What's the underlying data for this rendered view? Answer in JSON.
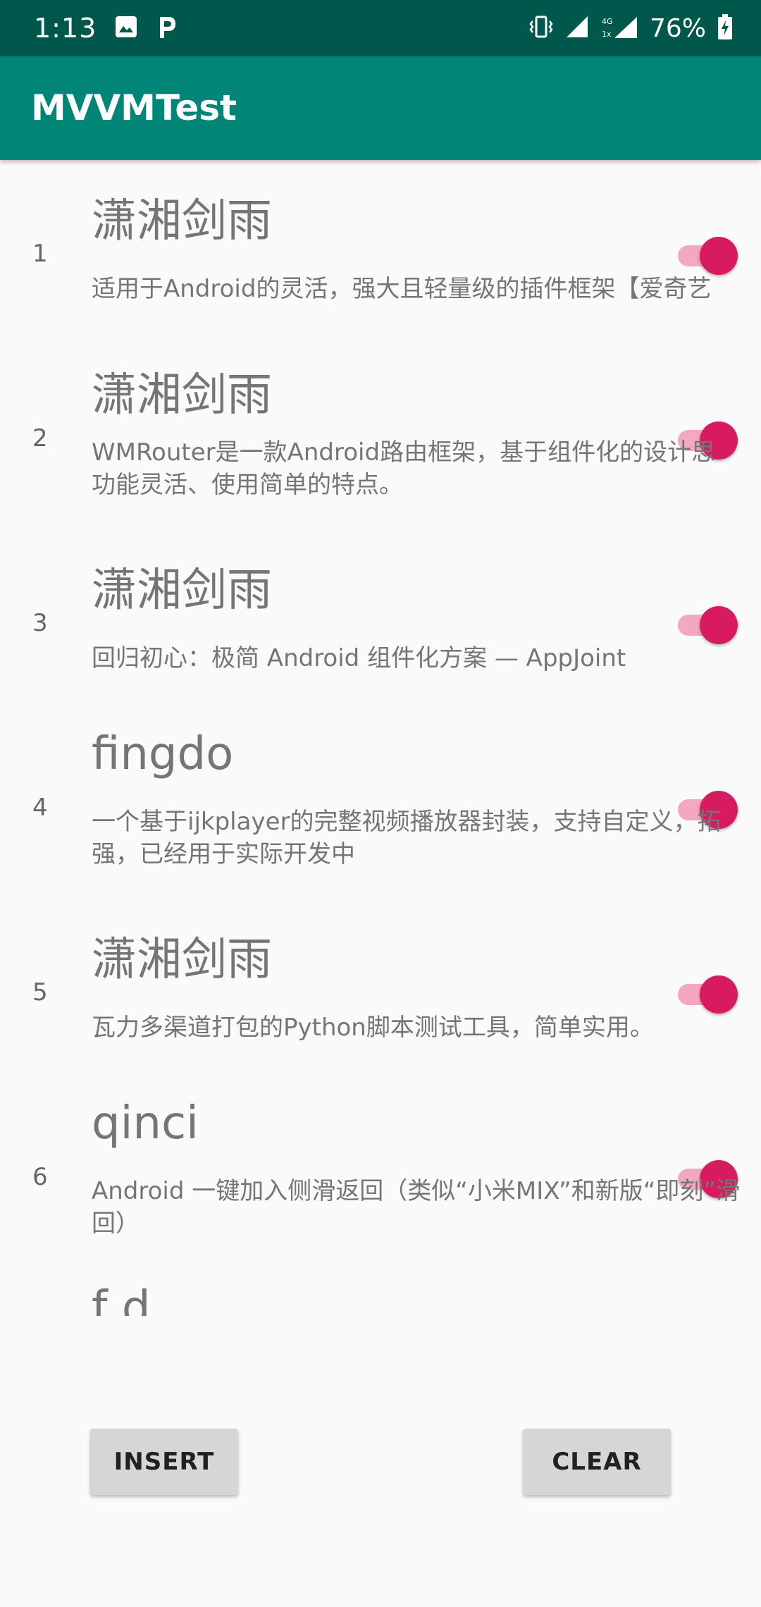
{
  "status_bar": {
    "time": "1:13",
    "battery": "76%",
    "icons": [
      "image-icon",
      "parking-icon",
      "vibrate-icon",
      "signal-icon",
      "data-4g-icon",
      "battery-charging-icon"
    ]
  },
  "app_bar": {
    "title": "MVVMTest"
  },
  "list": {
    "items": [
      {
        "index": "1",
        "title": "潇湘剑雨",
        "description": "适用于Android的灵活，强大且轻量级的插件框架【爱奇艺",
        "checked": true
      },
      {
        "index": "2",
        "title": "潇湘剑雨",
        "description": "WMRouter是一款Android路由框架，基于组件化的设计思\n功能灵活、使用简单的特点。",
        "checked": true
      },
      {
        "index": "3",
        "title": "潇湘剑雨",
        "description": "回归初心：极简 Android 组件化方案 — AppJoint",
        "checked": true
      },
      {
        "index": "4",
        "title": "fingdo",
        "description": "一个基于ijkplayer的完整视频播放器封装，支持自定义，拓\n强，已经用于实际开发中",
        "checked": true
      },
      {
        "index": "5",
        "title": "潇湘剑雨",
        "description": "瓦力多渠道打包的Python脚本测试工具，简单实用。",
        "checked": true
      },
      {
        "index": "6",
        "title": "qinci",
        "description": "Android 一键加入侧滑返回（类似“小米MIX”和新版“即刻”滑\n回）",
        "checked": true
      },
      {
        "index": "",
        "title": "f       d",
        "description": "",
        "checked": null
      }
    ]
  },
  "buttons": {
    "insert_label": "INSERT",
    "clear_label": "CLEAR"
  },
  "colors": {
    "status_bar": "#00574b",
    "app_bar": "#008577",
    "switch_thumb": "#d81b60",
    "switch_track": "#f3a8c0",
    "background": "#fafafa",
    "button": "#d6d6d6"
  }
}
